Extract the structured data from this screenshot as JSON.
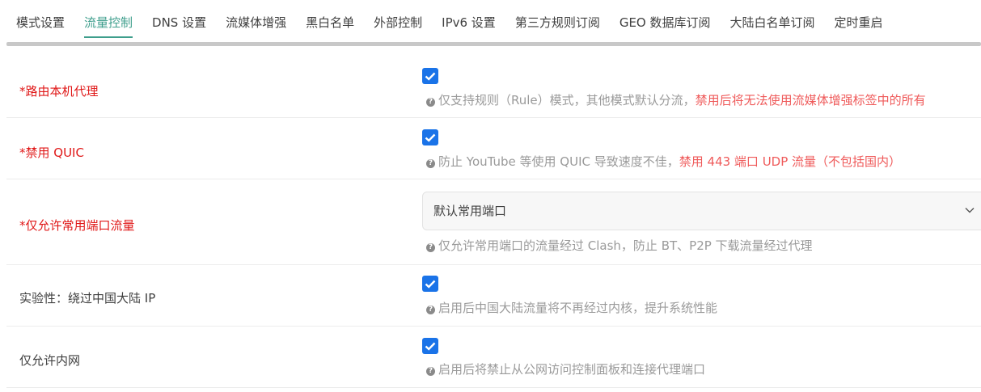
{
  "tabs": [
    {
      "label": "模式设置",
      "active": false
    },
    {
      "label": "流量控制",
      "active": true
    },
    {
      "label": "DNS 设置",
      "active": false
    },
    {
      "label": "流媒体增强",
      "active": false
    },
    {
      "label": "黑白名单",
      "active": false
    },
    {
      "label": "外部控制",
      "active": false
    },
    {
      "label": "IPv6 设置",
      "active": false
    },
    {
      "label": "第三方规则订阅",
      "active": false
    },
    {
      "label": "GEO 数据库订阅",
      "active": false
    },
    {
      "label": "大陆白名单订阅",
      "active": false
    },
    {
      "label": "定时重启",
      "active": false
    }
  ],
  "accent_color": "#3e9e8c",
  "checkbox_color": "#1a73e8",
  "required_color": "#e01818",
  "warning_color": "#ef5a5a",
  "settings": {
    "router_proxy": {
      "label": "*路由本机代理",
      "checked": true,
      "help": "仅支持规则（Rule）模式，其他模式默认分流，",
      "help_warn": "禁用后将无法使用流媒体增强标签中的所有"
    },
    "disable_quic": {
      "label": "*禁用 QUIC",
      "checked": true,
      "help": "防止 YouTube 等使用 QUIC 导致速度不佳，",
      "help_warn": "禁用 443 端口 UDP 流量（不包括国内）"
    },
    "common_ports": {
      "label": "*仅允许常用端口流量",
      "select_value": "默认常用端口",
      "help": "仅允许常用端口的流量经过 Clash，防止 BT、P2P 下载流量经过代理"
    },
    "bypass_china": {
      "label": "实验性：绕过中国大陆 IP",
      "checked": true,
      "help": "启用后中国大陆流量将不再经过内核，提升系统性能"
    },
    "lan_only": {
      "label": "仅允许内网",
      "checked": true,
      "help": "启用后将禁止从公网访问控制面板和连接代理端口"
    }
  }
}
